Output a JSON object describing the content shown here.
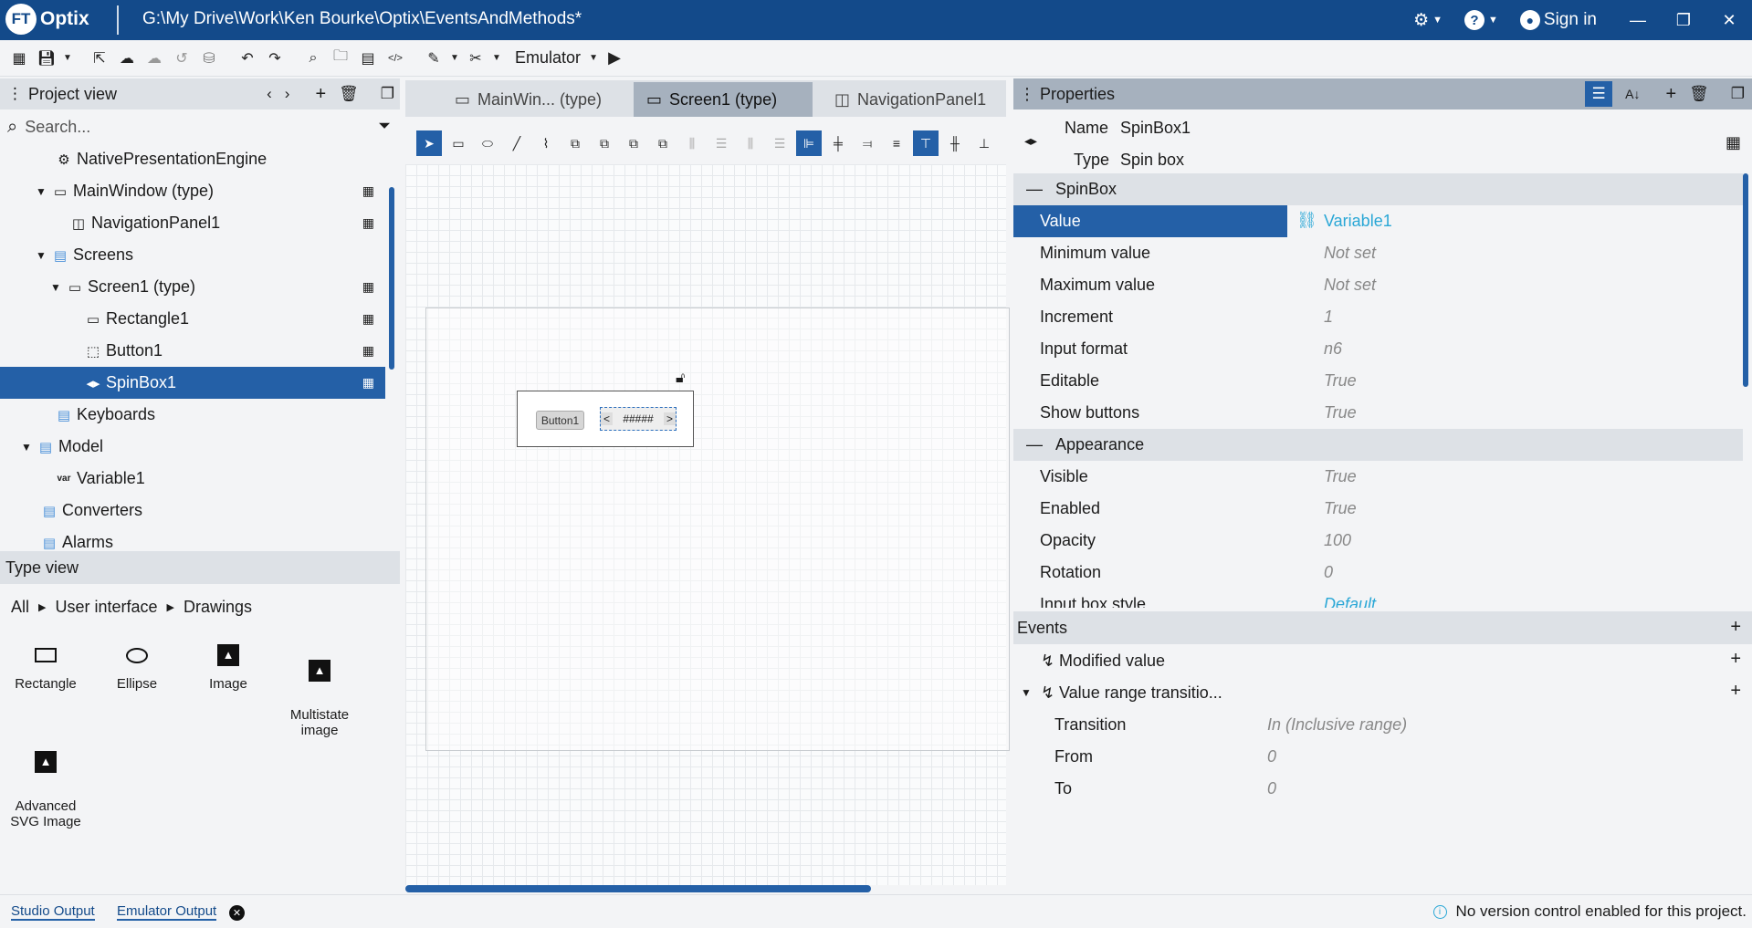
{
  "app": {
    "logo_badge": "FT",
    "logo_name": "Optix",
    "path": "G:\\My Drive\\Work\\Ken Bourke\\Optix\\EventsAndMethods*",
    "sign_in": "Sign in"
  },
  "toolbar": {
    "emulator": "Emulator"
  },
  "project_view": {
    "title": "Project view",
    "search_placeholder": "Search...",
    "items": [
      {
        "label": "NativePresentationEngine",
        "icon": "gear-icon"
      },
      {
        "label": "MainWindow (type)",
        "icon": "window-icon"
      },
      {
        "label": "NavigationPanel1",
        "icon": "navpanel-icon"
      },
      {
        "label": "Screens",
        "icon": "folder-icon"
      },
      {
        "label": "Screen1 (type)",
        "icon": "monitor-icon"
      },
      {
        "label": "Rectangle1",
        "icon": "rectangle-icon"
      },
      {
        "label": "Button1",
        "icon": "button-icon"
      },
      {
        "label": "SpinBox1",
        "icon": "spinbox-icon"
      },
      {
        "label": "Keyboards",
        "icon": "folder-icon"
      },
      {
        "label": "Model",
        "icon": "folder-icon"
      },
      {
        "label": "Variable1",
        "icon": "var-icon",
        "glyph": "var"
      },
      {
        "label": "Converters",
        "icon": "folder-icon"
      },
      {
        "label": "Alarms",
        "icon": "folder-icon"
      }
    ]
  },
  "type_view": {
    "title": "Type view",
    "crumbs": [
      "All",
      "User interface",
      "Drawings"
    ],
    "tiles": [
      {
        "label": "Rectangle"
      },
      {
        "label": "Ellipse"
      },
      {
        "label": "Image"
      },
      {
        "label": "Multistate\nimage"
      },
      {
        "label": "Advanced\nSVG Image"
      }
    ]
  },
  "editor": {
    "tabs": [
      {
        "label": "MainWin... (type)"
      },
      {
        "label": "Screen1 (type)",
        "active": true
      },
      {
        "label": "NavigationPanel1"
      }
    ],
    "canvas": {
      "button_text": "Button1",
      "spin_text": "#####",
      "spin_left": "<",
      "spin_right": ">"
    }
  },
  "properties": {
    "title": "Properties",
    "name_label": "Name",
    "name_value": "SpinBox1",
    "type_label": "Type",
    "type_value": "Spin box",
    "sections": [
      {
        "title": "SpinBox",
        "rows": [
          {
            "key": "Value",
            "value": "Variable1",
            "selected": true,
            "link": true
          },
          {
            "key": "Minimum value",
            "value": "Not set"
          },
          {
            "key": "Maximum value",
            "value": "Not set"
          },
          {
            "key": "Increment",
            "value": "1"
          },
          {
            "key": "Input format",
            "value": "n6"
          },
          {
            "key": "Editable",
            "value": "True"
          },
          {
            "key": "Show buttons",
            "value": "True"
          }
        ]
      },
      {
        "title": "Appearance",
        "rows": [
          {
            "key": "Visible",
            "value": "True"
          },
          {
            "key": "Enabled",
            "value": "True"
          },
          {
            "key": "Opacity",
            "value": "100"
          },
          {
            "key": "Rotation",
            "value": "0"
          },
          {
            "key": "Input box style",
            "value": "Default",
            "link": true
          }
        ]
      }
    ]
  },
  "events": {
    "title": "Events",
    "items": [
      {
        "label": "Modified value"
      },
      {
        "label": "Value range transitio..."
      }
    ],
    "params": [
      {
        "key": "Transition",
        "value": "In (Inclusive range)"
      },
      {
        "key": "From",
        "value": "0"
      },
      {
        "key": "To",
        "value": "0"
      }
    ]
  },
  "status": {
    "studio_output": "Studio Output",
    "emulator_output": "Emulator Output",
    "vcs": "No version control enabled for this project."
  }
}
